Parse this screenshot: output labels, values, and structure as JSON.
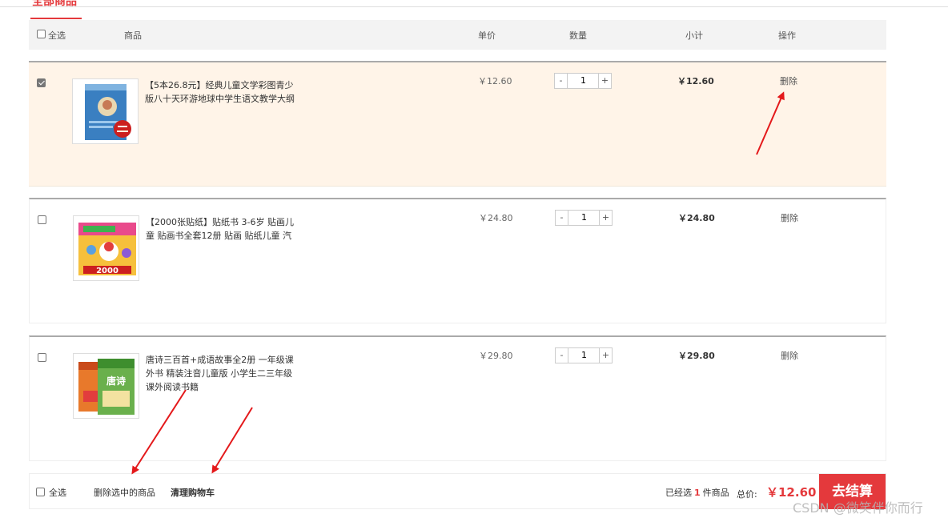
{
  "top_tab": {
    "label": "全部商品"
  },
  "header": {
    "select_all_label": "全选",
    "col_goods": "商品",
    "col_price": "单价",
    "col_qty": "数量",
    "col_subtotal": "小计",
    "col_action": "操作"
  },
  "items": [
    {
      "checked": true,
      "title": "【5本26.8元】经典儿童文学彩图青少版八十天环游地球中学生语文教学大纲",
      "price": "￥12.60",
      "qty": "1",
      "subtotal": "￥12.60",
      "delete_label": "删除",
      "thumb_color": "#3a7fc1"
    },
    {
      "checked": false,
      "title": "【2000张贴纸】贴纸书 3-6岁 贴画儿童 贴画书全套12册 贴画 贴纸儿童 汽",
      "price": "￥24.80",
      "qty": "1",
      "subtotal": "￥24.80",
      "delete_label": "删除",
      "thumb_color": "#f0a81c",
      "thumb_text": "2000"
    },
    {
      "checked": false,
      "title": "唐诗三百首+成语故事全2册 一年级课外书 精装注音儿童版 小学生二三年级课外阅读书籍",
      "price": "￥29.80",
      "qty": "1",
      "subtotal": "￥29.80",
      "delete_label": "删除",
      "thumb_color": "#6ab04c",
      "thumb_text": "唐诗"
    }
  ],
  "qty_minus": "-",
  "qty_plus": "+",
  "footer": {
    "select_all_label": "全选",
    "delete_selected": "删除选中的商品",
    "clear_cart": "清理购物车",
    "selected_prefix": "已经选",
    "selected_count": "1",
    "selected_suffix": "件商品",
    "total_label": "总价:",
    "total_value": "￥12.60",
    "checkout_label": "去结算"
  },
  "watermark": "CSDN @微笑伴你而行",
  "colors": {
    "accent": "#e4393c",
    "selected_row_bg": "#fff4e8",
    "header_bg": "#f3f3f3"
  }
}
